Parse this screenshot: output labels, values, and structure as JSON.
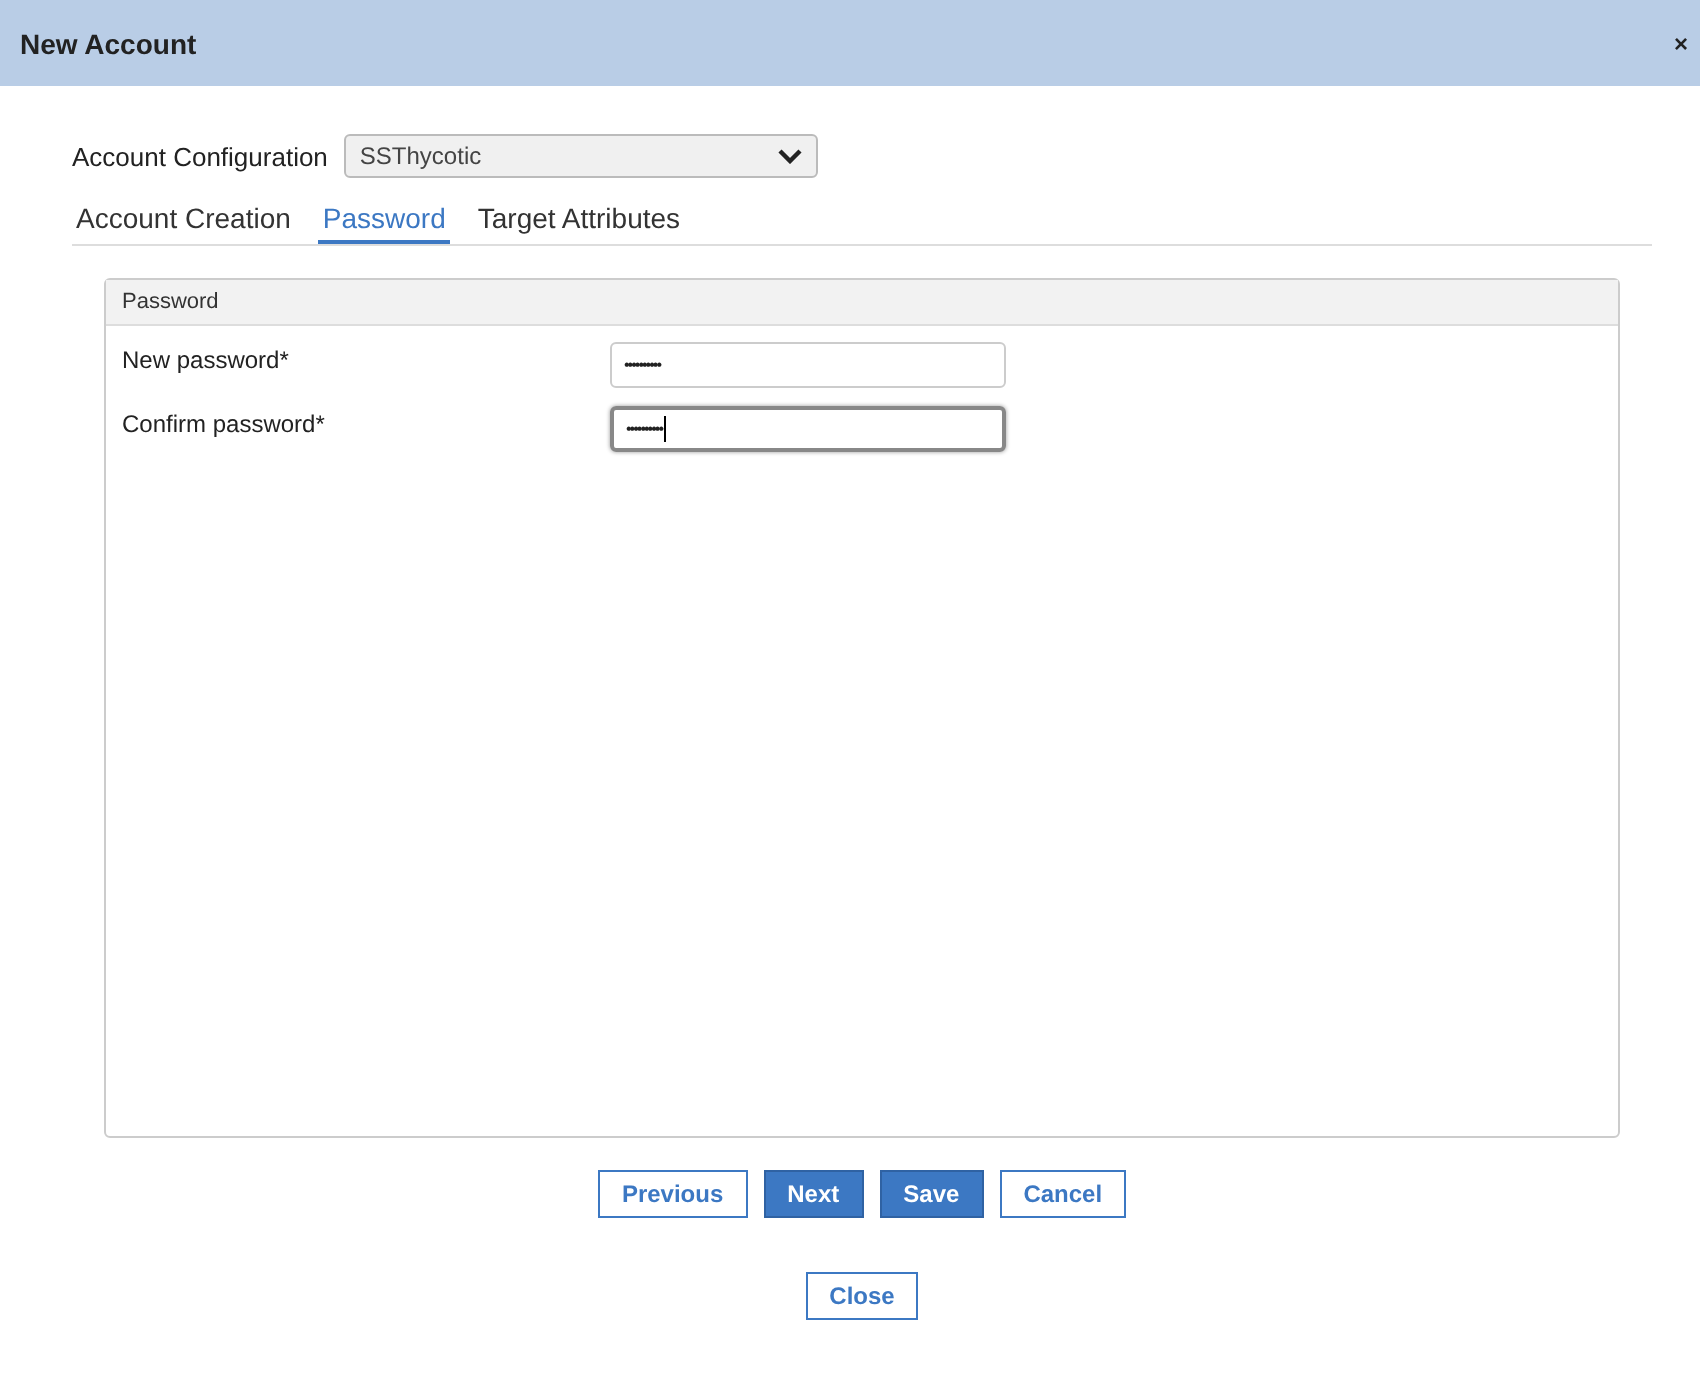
{
  "window": {
    "title": "New Account",
    "close": "×"
  },
  "account_configuration": {
    "label": "Account Configuration",
    "value": "SSThycotic"
  },
  "tabs": [
    {
      "label": "Account Creation",
      "selected": false
    },
    {
      "label": "Password",
      "selected": true
    },
    {
      "label": "Target Attributes",
      "selected": false
    }
  ],
  "panel": {
    "title": "Password",
    "fields": [
      {
        "label": "New password*",
        "value": "••••••••••",
        "focused": false
      },
      {
        "label": "Confirm password*",
        "value": "••••••••••",
        "focused": true
      }
    ]
  },
  "buttons": [
    {
      "label": "Previous",
      "kind": "secondary"
    },
    {
      "label": "Next",
      "kind": "primary"
    },
    {
      "label": "Save",
      "kind": "primary"
    },
    {
      "label": "Cancel",
      "kind": "secondary"
    }
  ],
  "close_button": "Close"
}
